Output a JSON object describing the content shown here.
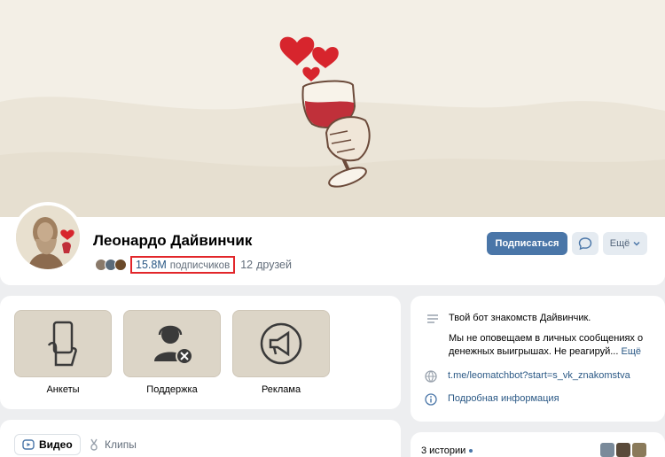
{
  "profile": {
    "name": "Леонардо Дайвинчик",
    "followers_count": "15.8M",
    "followers_label": "подписчиков",
    "friends_count": "12",
    "friends_label": "друзей"
  },
  "actions": {
    "subscribe_label": "Подписаться",
    "more_label": "Ещё"
  },
  "apps": [
    {
      "label": "Анкеты",
      "icon": "phone-hand-icon"
    },
    {
      "label": "Поддержка",
      "icon": "support-agent-icon"
    },
    {
      "label": "Реклама",
      "icon": "megaphone-icon"
    }
  ],
  "info": {
    "tagline": "Твой бот знакомств Дайвинчик.",
    "description": "Мы не оповещаем в личных сообщениях о денежных выигрышах. Не реагируй...",
    "more_link": "Ещё",
    "url": "t.me/leomatchbot?start=s_vk_znakomstva",
    "details_link": "Подробная информация"
  },
  "tabs": {
    "video": "Видео",
    "clips": "Клипы"
  },
  "stories": {
    "label": "3 истории"
  },
  "colors": {
    "accent": "#4a76a8",
    "highlight": "#e2262a",
    "cover_bg": "#f3efe6",
    "wine": "#c0303a"
  }
}
